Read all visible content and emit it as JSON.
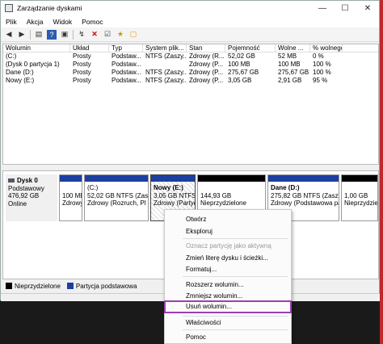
{
  "window": {
    "title": "Zarządzanie dyskami",
    "controls": {
      "minimize": "—",
      "maximize": "☐",
      "close": "✕"
    }
  },
  "menu": [
    "Plik",
    "Akcja",
    "Widok",
    "Pomoc"
  ],
  "toolbar": [
    "arrow-left-icon",
    "arrow-right-icon",
    "list-icon",
    "help-icon",
    "panel-icon",
    "connect-icon",
    "delete-icon",
    "check-icon",
    "new-icon",
    "folder-icon"
  ],
  "volume_table": {
    "headers": [
      "Wolumin",
      "Układ",
      "Typ",
      "System plik...",
      "Stan",
      "Pojemność",
      "Wolne ...",
      "% wolnego"
    ],
    "rows": [
      [
        "(C:)",
        "Prosty",
        "Podstaw...",
        "NTFS (Zaszy...",
        "Zdrowy (R...",
        "52,02 GB",
        "52 MB",
        "0 %"
      ],
      [
        "(Dysk 0 partycja 1)",
        "Prosty",
        "Podstaw...",
        "",
        "Zdrowy (P...",
        "100 MB",
        "100 MB",
        "100 %"
      ],
      [
        "Dane (D:)",
        "Prosty",
        "Podstaw...",
        "NTFS (Zaszy...",
        "Zdrowy (P...",
        "275,67 GB",
        "275,67 GB",
        "100 %"
      ],
      [
        "Nowy (E:)",
        "Prosty",
        "Podstaw...",
        "NTFS (Zaszy...",
        "Zdrowy (P...",
        "3,05 GB",
        "2,91 GB",
        "95 %"
      ]
    ]
  },
  "disk": {
    "name": "Dysk 0",
    "type": "Podstawowy",
    "size": "476,92 GB",
    "status": "Online",
    "partitions": [
      {
        "l1": "",
        "l2": "100 MB",
        "l3": "Zdrowy",
        "kind": "primary"
      },
      {
        "l1": "(C:)",
        "l2": "52,02 GB NTFS (Zaszy",
        "l3": "Zdrowy (Rozruch, Pl",
        "kind": "primary"
      },
      {
        "l1": "Nowy  (E:)",
        "l2": "3,05 GB NTFS (Zas",
        "l3": "Zdrowy (Partycja",
        "kind": "primary",
        "selected": true
      },
      {
        "l1": "",
        "l2": "144,93 GB",
        "l3": "Nieprzydzielone",
        "kind": "unallocated"
      },
      {
        "l1": "Dane  (D:)",
        "l2": "275,82 GB NTFS (Zaszyfrc",
        "l3": "Zdrowy (Podstawowa pa",
        "kind": "primary"
      },
      {
        "l1": "",
        "l2": "1,00 GB",
        "l3": "Nieprzydzie",
        "kind": "unallocated"
      }
    ]
  },
  "legend": [
    {
      "label": "Nieprzydzielone",
      "color": "#000000"
    },
    {
      "label": "Partycja podstawowa",
      "color": "#1c3fa0"
    }
  ],
  "context_menu": [
    {
      "label": "Otwórz",
      "enabled": true
    },
    {
      "label": "Eksploruj",
      "enabled": true
    },
    {
      "label": "Oznacz partycję jako aktywną",
      "enabled": false
    },
    {
      "label": "Zmień literę dysku i ścieżki...",
      "enabled": true
    },
    {
      "label": "Formatuj...",
      "enabled": true
    },
    {
      "label": "Rozszerz wolumin...",
      "enabled": false
    },
    {
      "label": "Zmniejsz wolumin...",
      "enabled": true
    },
    {
      "label": "Usuń wolumin...",
      "enabled": true,
      "highlighted": true
    },
    {
      "label": "Właściwości",
      "enabled": true
    },
    {
      "label": "Pomoc",
      "enabled": true
    }
  ]
}
